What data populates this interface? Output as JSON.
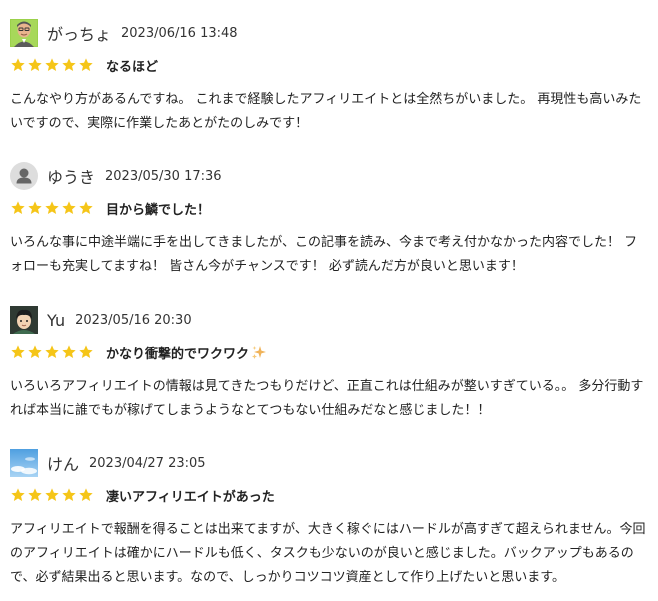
{
  "reviews": [
    {
      "avatar": "photo-avatar",
      "name": "がっちょ",
      "date": "2023/06/16 13:48",
      "rating": 5,
      "title": "なるほど",
      "body": "こんなやり方があるんですね。 これまで経験したアフィリエイトとは全然ちがいました。 再現性も高いみたいですので、実際に作業したあとがたのしみです！"
    },
    {
      "avatar": "default-user-icon",
      "name": "ゆうき",
      "date": "2023/05/30 17:36",
      "rating": 5,
      "title": "目から鱗でした！",
      "body": "いろんな事に中途半端に手を出してきましたが、この記事を読み、今まで考え付かなかった内容でした！ フォローも充実してますね！ 皆さん今がチャンスです！ 必ず読んだ方が良いと思います！"
    },
    {
      "avatar": "illustrated-avatar",
      "name": "Yu",
      "date": "2023/05/16 20:30",
      "rating": 5,
      "title": "かなり衝撃的でワクワク",
      "title_icon": "sparkle-icon",
      "body": "いろいろアフィリエイトの情報は見てきたつもりだけど、正直これは仕組みが整いすぎている。。 多分行動すれば本当に誰でもが稼げてしまうようなとてつもない仕組みだなと感じました！！"
    },
    {
      "avatar": "sky-avatar",
      "name": "けん",
      "date": "2023/04/27 23:05",
      "rating": 5,
      "title": "凄いアフィリエイトがあった",
      "body": "アフィリエイトで報酬を得ることは出来てますが、大きく稼ぐにはハードルが高すぎて超えられません。今回のアフィリエイトは確かにハードルも低く、タスクも少ないのが良いと感じました。バックアップもあるので、必ず結果出ると思います。なので、しっかりコツコツ資産として作り上げたいと思います。"
    }
  ],
  "colors": {
    "star": "#f5c518",
    "text": "#222222",
    "sparkle": "#f0b35a"
  }
}
